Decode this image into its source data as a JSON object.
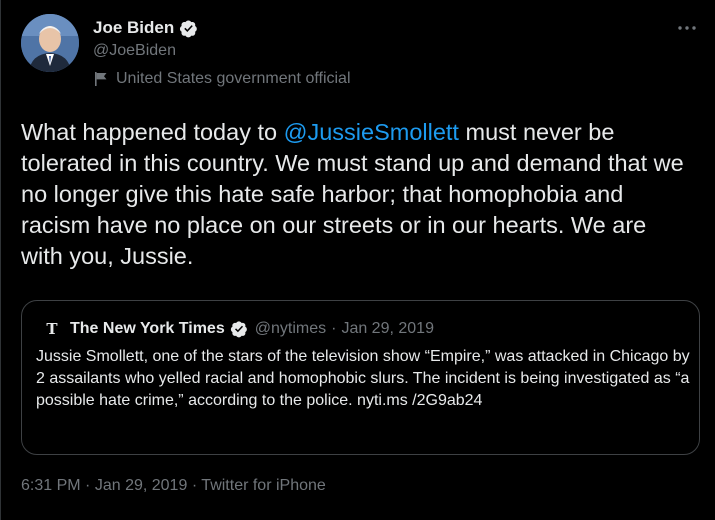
{
  "author": {
    "display_name": "Joe Biden",
    "handle": "@JoeBiden",
    "label": "United States government official",
    "verified_icon": "verified-badge-icon",
    "avatar": "avatar"
  },
  "more_icon": "more-options-icon",
  "tweet": {
    "text_before": "What happened today to ",
    "mention": "@JussieSmollett",
    "text_after": " must never be tolerated in this country. We must stand up and demand that we no longer give this hate safe harbor; that homophobia and racism have no place on our streets or in our hearts. We are with you, Jussie."
  },
  "quoted_tweet": {
    "display_name": "The New York Times",
    "handle": "@nytimes",
    "separator": "·",
    "date": "Jan 29, 2019",
    "text": "Jussie Smollett, one of the stars of the television show “Empire,” was attacked in Chicago by 2 assailants who yelled racial and homophobic slurs. The incident is being investigated as “a possible hate crime,” according to the police. nyti.ms /2G9ab24"
  },
  "footer": {
    "time": "6:31 PM",
    "separator": "·",
    "date": "Jan 29, 2019",
    "source": "Twitter for iPhone"
  },
  "colors": {
    "background": "#000000",
    "text": "#e7e9ea",
    "secondary": "#71767b",
    "link": "#1d9bf0",
    "border": "#3e4144"
  }
}
